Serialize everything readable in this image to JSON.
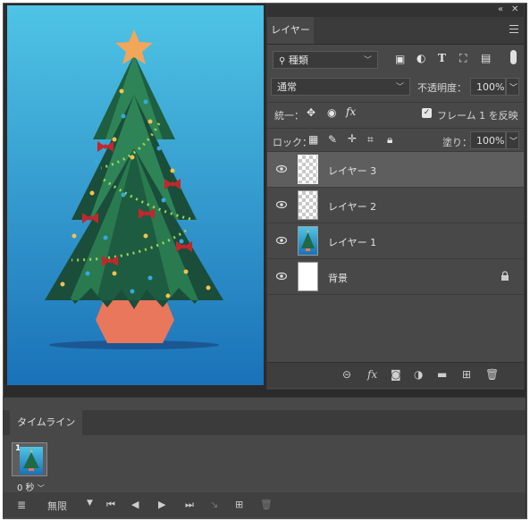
{
  "layers_panel": {
    "tab_label": "レイヤー",
    "filter": {
      "label": "種類"
    },
    "blend_mode": "通常",
    "opacity": {
      "label": "不透明度：",
      "value": "100%"
    },
    "unify": {
      "label": "統一："
    },
    "propagate_frame": {
      "label": "フレーム 1 を反映",
      "checked": true
    },
    "lock": {
      "label": "ロック："
    },
    "fill": {
      "label": "塗り：",
      "value": "100%"
    },
    "layers": [
      {
        "name": "レイヤー 3",
        "selected": true,
        "thumbnail": "transparent"
      },
      {
        "name": "レイヤー 2",
        "selected": false,
        "thumbnail": "transparent"
      },
      {
        "name": "レイヤー 1",
        "selected": false,
        "thumbnail": "tree"
      },
      {
        "name": "背景",
        "selected": false,
        "thumbnail": "white",
        "locked": true
      }
    ]
  },
  "timeline_panel": {
    "tab_label": "タイムライン",
    "frames": [
      {
        "number": "1",
        "delay": "0 秒"
      }
    ],
    "loop": "無限"
  },
  "colors": {
    "panel_bg": "#484848",
    "selected_row": "#5e5e5e",
    "sky_top": "#4fc4e5",
    "sky_bottom": "#1a72b8",
    "tree_dark": "#1a4d3a",
    "tree_light": "#2e8457",
    "star": "#f2a65a",
    "pot": "#e8775c"
  }
}
